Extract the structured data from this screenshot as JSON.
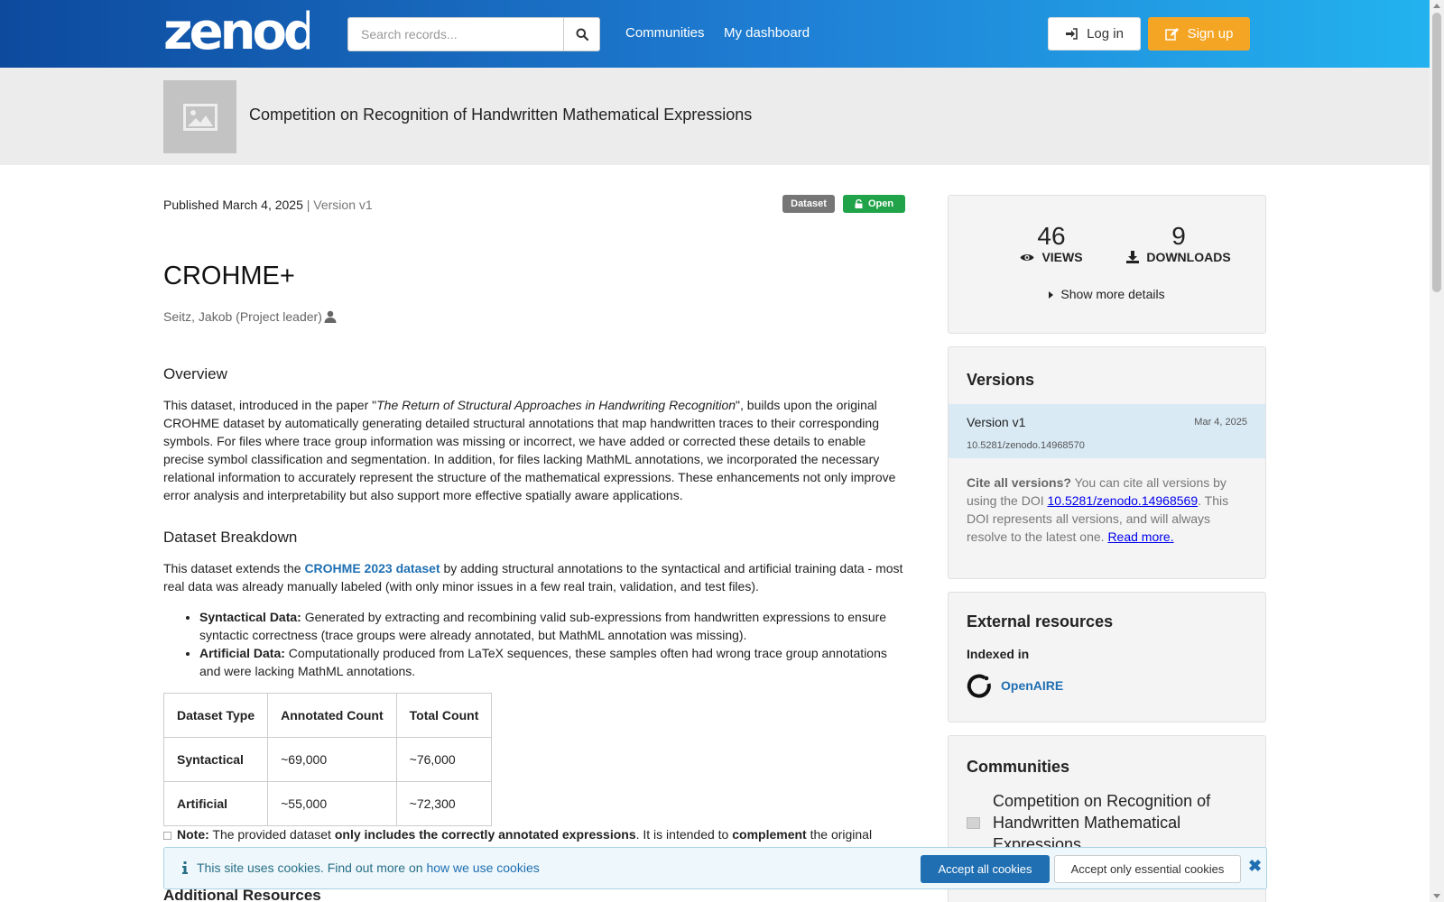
{
  "header": {
    "logo_text": "zenodo",
    "search_placeholder": "Search records...",
    "nav": [
      "Communities",
      "My dashboard"
    ],
    "login_label": "Log in",
    "signup_label": "Sign up"
  },
  "community": {
    "title": "Competition on Recognition of Handwritten Mathematical Expressions"
  },
  "record": {
    "published": "Published March 4, 2025",
    "version_sep": " | Version v1",
    "badge_type": "Dataset",
    "badge_access": "Open",
    "title": "CROHME+",
    "creator": "Seitz, Jakob (Project leader)",
    "overview_heading": "Overview",
    "overview_p1": "This dataset, introduced in the paper \"",
    "overview_paper": "The Return of Structural Approaches in Handwriting Recognition",
    "overview_p2": "\", builds upon the original CROHME dataset by automatically generating detailed structural annotations that map handwritten traces to their corresponding symbols. For files where trace group information was missing or incorrect, we have added or corrected these details to enable precise symbol classification and segmentation. In addition, for files lacking MathML annotations, we incorporated the necessary relational information to accurately represent the structure of the mathematical expressions. These enhancements not only improve error analysis and interpretability but also support more effective spatially aware applications.",
    "breakdown_heading": "Dataset Breakdown",
    "breakdown_p1": "This dataset extends the ",
    "breakdown_link": "CROHME 2023 dataset",
    "breakdown_p2": " by adding structural annotations to the syntactical and artificial training data - most real data was already manually labeled (with only minor issues in a few real train, validation, and test files).",
    "bullets": [
      {
        "label": "Syntactical Data:",
        "text": " Generated by extracting and recombining valid sub-expressions from handwritten expressions to ensure syntactic correctness (trace groups were already annotated, but MathML annotation was missing)."
      },
      {
        "label": "Artificial Data:",
        "text": " Computationally produced from LaTeX sequences, these samples often had wrong trace group annotations and were lacking MathML annotations."
      }
    ],
    "table": {
      "headers": [
        "Dataset Type",
        "Annotated Count",
        "Total Count"
      ],
      "rows": [
        [
          "Syntactical",
          "~69,000",
          "~76,000"
        ],
        [
          "Artificial",
          "~55,000",
          "~72,300"
        ]
      ]
    },
    "note_label": "Note:",
    "note_t1": " The provided dataset ",
    "note_b1": "only includes the correctly annotated expressions",
    "note_t2": ". It is intended to ",
    "note_b2": "complement",
    "note_t3": " the original",
    "additional_heading": "Additional Resources"
  },
  "sidebar": {
    "views_count": "46",
    "views_label": "VIEWS",
    "downloads_count": "9",
    "downloads_label": "DOWNLOADS",
    "show_more": "Show more details",
    "versions_heading": "Versions",
    "version_name": "Version v1",
    "version_date": "Mar 4, 2025",
    "version_doi": "10.5281/zenodo.14968570",
    "cite_bold": "Cite all versions?",
    "cite_t1": " You can cite all versions by using the DOI ",
    "cite_doi": "10.5281/zenodo.14968569",
    "cite_t2": ". This DOI represents all versions, and will always resolve to the latest one. ",
    "cite_read_more": "Read more.",
    "external_heading": "External resources",
    "indexed_in": "Indexed in",
    "openaire": "OpenAIRE",
    "communities_heading": "Communities",
    "community_name": "Competition on Recognition of Handwritten Mathematical Expressions"
  },
  "cookie": {
    "text": "This site uses cookies. Find out more on ",
    "link": "how we use cookies",
    "accept_all": "Accept all cookies",
    "accept_essential": "Accept only essential cookies"
  },
  "colors": {
    "header_start": "#0d4a9e",
    "header_end": "#23b4f0",
    "signup": "#f5a524",
    "open_badge": "#21a349",
    "link": "#1f6fb2"
  }
}
